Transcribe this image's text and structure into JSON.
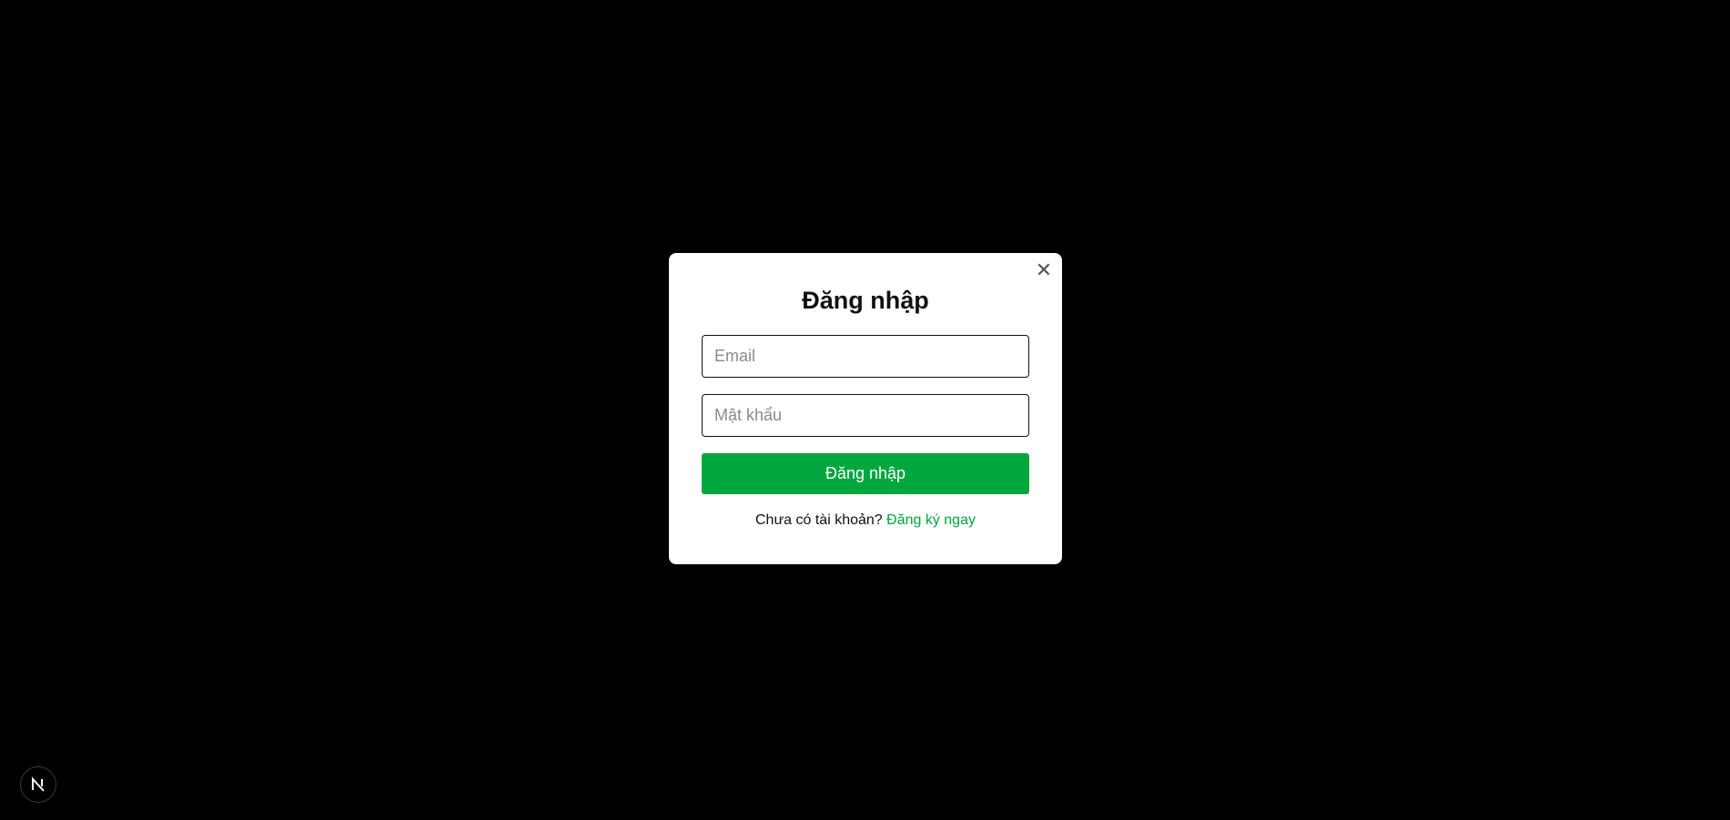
{
  "modal": {
    "title": "Đăng nhập",
    "close_label": "✕",
    "email": {
      "placeholder": "Email",
      "value": ""
    },
    "password": {
      "placeholder": "Mật khẩu",
      "value": ""
    },
    "submit_label": "Đăng nhập",
    "footer_prompt": "Chưa có tài khoản?",
    "register_link": "Đăng ký ngay"
  },
  "colors": {
    "background": "#000000",
    "modal": "#ffffff",
    "accent": "#00a63e"
  },
  "badge": {
    "icon": "nextjs-logo-icon"
  }
}
